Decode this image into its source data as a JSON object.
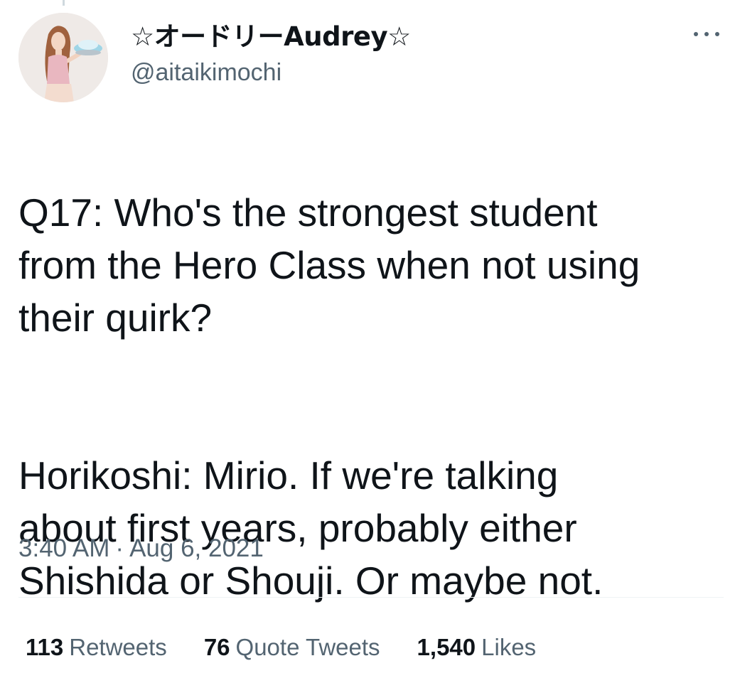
{
  "author": {
    "display_name": "☆オードリーAudrey☆",
    "handle": "@aitaikimochi",
    "avatar_icon": "profile-photo"
  },
  "tweet": {
    "paragraph_1": "Q17: Who's the strongest student\nfrom the Hero Class when not using\ntheir quirk?",
    "paragraph_2": "Horikoshi: Mirio. If we're talking\nabout first years, probably either\nShishida or Shouji. Or maybe not.",
    "time": "3:40 AM",
    "separator": "·",
    "date": "Aug 6, 2021"
  },
  "stats": {
    "retweets_count": "113",
    "retweets_label": "Retweets",
    "quotes_count": "76",
    "quotes_label": "Quote Tweets",
    "likes_count": "1,540",
    "likes_label": "Likes"
  },
  "colors": {
    "text_primary": "#0f1419",
    "text_secondary": "#536471",
    "divider": "#eff3f4"
  }
}
